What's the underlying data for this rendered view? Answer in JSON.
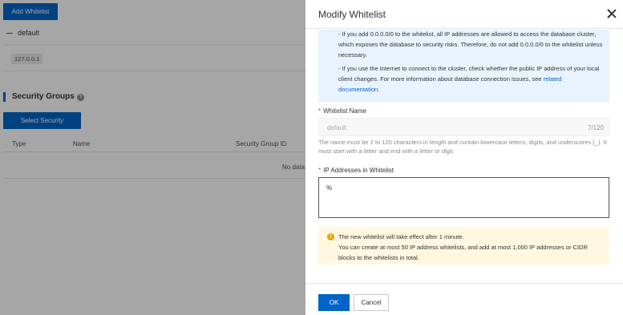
{
  "background": {
    "add_whitelist_button": "Add Whitelist",
    "group_name": "default",
    "ip_tag": "127.0.0.1",
    "security_groups_title": "Security Groups",
    "help_icon": "question-circle-icon",
    "select_security_groups_button": "Select Security Groups",
    "table_headers": [
      "Type",
      "Name",
      "Security Group ID"
    ],
    "no_data": "No data"
  },
  "drawer": {
    "title": "Modify Whitelist",
    "close_icon": "close-icon",
    "info": {
      "para1": "- If you add 0.0.0.0/0 to the whitelist, all IP addresses are allowed to access the database cluster, which exposes the database to security risks. Therefore, do not add 0.0.0.0/0 to the whitelist unless necessary.",
      "para2_text": "- If you use the Internet to connect to the cluster, check whether the public IP address of your local client changes. For more information about database connection issues, see ",
      "para2_link": "related documentation",
      "para2_end": "."
    },
    "whitelist_name": {
      "required_mark": "*",
      "label": "Whitelist Name",
      "value": "default",
      "counter": "7/120",
      "hint": "The name must be 2 to 120 characters in length and contain lowercase letters, digits, and underscores (_). It must start with a letter and end with a letter or digit."
    },
    "ip_addresses": {
      "required_mark": "*",
      "label": "IP Addresses in Whitelist",
      "value": "%"
    },
    "notice": {
      "icon": "warning-icon",
      "line1": "The new whitelist will take effect after 1 minute.",
      "line2": "You can create at most 50 IP address whitelists, and add at most 1,000 IP addresses or CIDR blocks to the whitelists in total."
    },
    "ok_button": "OK",
    "cancel_button": "Cancel"
  },
  "colors": {
    "primary": "#0064c8",
    "info_bg": "#e8f3ff",
    "warn_bg": "#fff7e0",
    "warn_icon": "#f0a000",
    "required": "#d93026"
  }
}
